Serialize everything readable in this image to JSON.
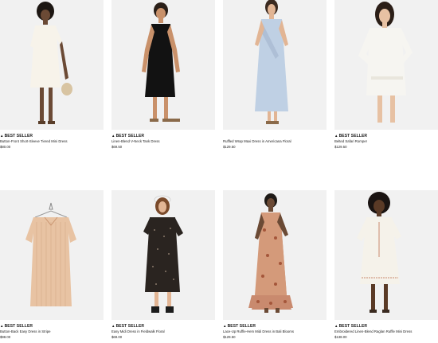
{
  "products": [
    {
      "badge": "BEST SELLER",
      "name": "Button-Front Short-Sleeve Tiered Mini Dress",
      "price": "$80.00"
    },
    {
      "badge": "BEST SELLER",
      "name": "Linen-Blend V-Neck Tank Dress",
      "price": "$69.50"
    },
    {
      "badge": "",
      "name": "Ruffled Wrap Maxi Dress in Americana Floral",
      "price": "$129.50"
    },
    {
      "badge": "BEST SELLER",
      "name": "Belted Safari Romper",
      "price": "$129.50"
    },
    {
      "badge": "BEST SELLER",
      "name": "Button-Back Easy Dress in Stripe",
      "price": "$98.00"
    },
    {
      "badge": "BEST SELLER",
      "name": "Easy Midi Dress in Fieldwalk Floral",
      "price": "$69.00"
    },
    {
      "badge": "BEST SELLER",
      "name": "Lace-Up Ruffle-Hem Midi Dress in Bali Blooms",
      "price": "$129.50"
    },
    {
      "badge": "BEST SELLER",
      "name": "Embroidered Linen-Blend Raglan Ruffle Mini Dress",
      "price": "$138.00"
    }
  ],
  "icons": {
    "badge_icon": "triangle-icon"
  },
  "colors": {
    "page_background": "#ffffff",
    "image_background": "#efefef",
    "text": "#1a1a1a"
  }
}
